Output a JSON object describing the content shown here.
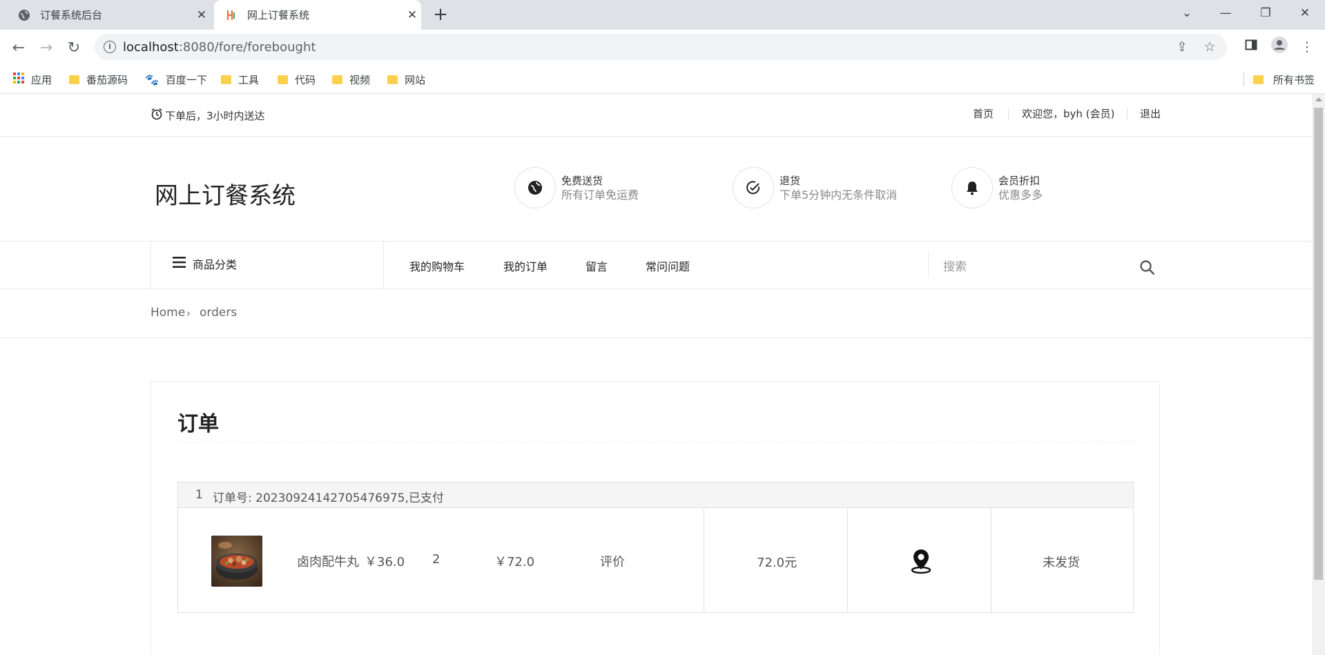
{
  "browser": {
    "tabs": [
      {
        "title": "订餐系统后台",
        "active": false,
        "icon": "globe-icon"
      },
      {
        "title": "网上订餐系统",
        "active": true,
        "icon": "site-favicon"
      }
    ],
    "url_host": "localhost",
    "url_rest": ":8080/fore/forebought",
    "bookmarks": [
      {
        "label": "应用",
        "icon": "apps-grid-icon"
      },
      {
        "label": "番茄源码",
        "icon": "folder-icon"
      },
      {
        "label": "百度一下",
        "icon": "baidu-paw-icon"
      },
      {
        "label": "工具",
        "icon": "folder-icon"
      },
      {
        "label": "代码",
        "icon": "folder-icon"
      },
      {
        "label": "视频",
        "icon": "folder-icon"
      },
      {
        "label": "网站",
        "icon": "folder-icon"
      }
    ],
    "all_bookmarks": "所有书签"
  },
  "header": {
    "delivery_note": "下单后，3小时内送达",
    "home_link": "首页",
    "welcome": "欢迎您，byh (会员)",
    "logout": "退出"
  },
  "brand": {
    "title": "网上订餐系统"
  },
  "features": [
    {
      "title": "免费送货",
      "subtitle": "所有订单免运费",
      "icon": "globe-icon"
    },
    {
      "title": "退货",
      "subtitle": "下单5分钟内无条件取消",
      "icon": "check-circle-icon"
    },
    {
      "title": "会员折扣",
      "subtitle": "优惠多多",
      "icon": "bell-icon"
    }
  ],
  "nav": {
    "category": "商品分类",
    "menu": [
      "我的购物车",
      "我的订单",
      "留言",
      "常问问题"
    ],
    "search_placeholder": "搜索"
  },
  "breadcrumb": {
    "home": "Home",
    "current": "orders"
  },
  "orders_panel": {
    "title": "订单",
    "orders": [
      {
        "index": "1",
        "header": "订单号: 20230924142705476975,已支付",
        "product_name": "卤肉配牛丸",
        "unit_price": "￥36.0",
        "quantity": "2",
        "subtotal": "￥72.0",
        "review": "评价",
        "total": "72.0元",
        "status": "未发货"
      }
    ]
  },
  "colors": {
    "accent": "#222222",
    "folder": "#fbd14b",
    "tabbar": "#dee1e6"
  }
}
